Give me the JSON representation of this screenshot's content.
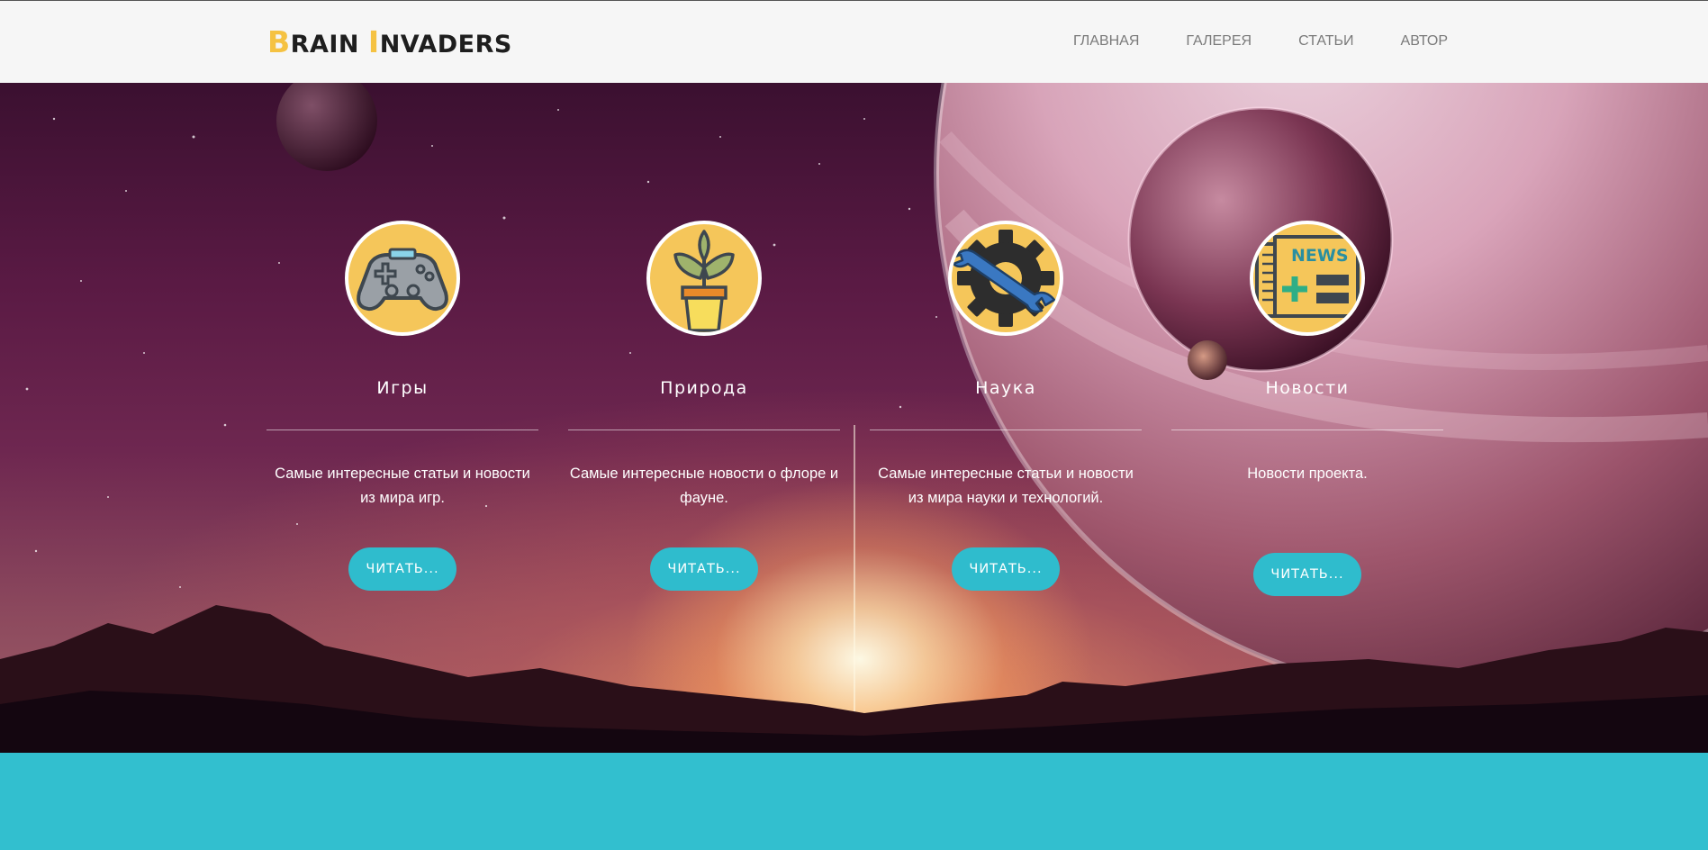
{
  "brand": {
    "first_cap": "B",
    "first_rest": "RAIN",
    "second_cap": "I",
    "second_rest": "NVADERS",
    "accent": "#f5c242"
  },
  "nav": [
    {
      "label": "ГЛАВНАЯ"
    },
    {
      "label": "ГАЛЕРЕЯ"
    },
    {
      "label": "СТАТЬИ"
    },
    {
      "label": "АВТОР"
    }
  ],
  "features": [
    {
      "icon": "gamepad-icon",
      "title": "Игры",
      "text": "Самые интересные статьи и новости из мира игр.",
      "button": "ЧИТАТЬ..."
    },
    {
      "icon": "plant-pot-icon",
      "title": "Природа",
      "text": "Самые интересные новости о флоре и фауне.",
      "button": "ЧИТАТЬ..."
    },
    {
      "icon": "wrench-gear-icon",
      "title": "Наука",
      "text": "Самые интересные статьи и новости из мира науки и технологий.",
      "button": "ЧИТАТЬ..."
    },
    {
      "icon": "newspaper-icon",
      "title": "Новости",
      "text": "Новости проекта.",
      "button": "ЧИТАТЬ..."
    }
  ],
  "colors": {
    "header_bg": "#f6f6f6",
    "icon_bg": "#f5c65a",
    "button_bg": "#2fbccd",
    "footer_bg": "#32bfcf"
  }
}
